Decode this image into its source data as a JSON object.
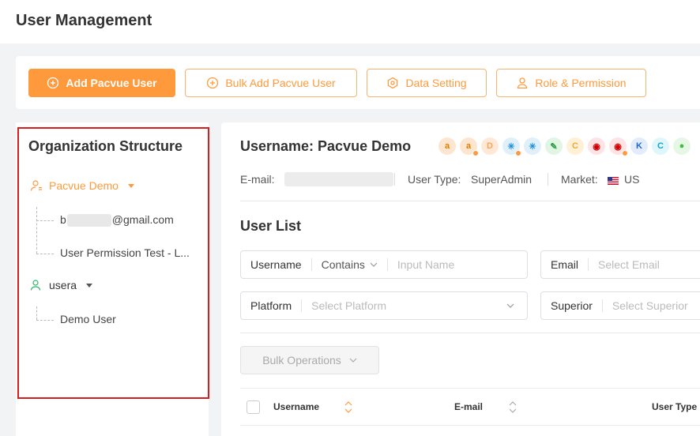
{
  "header": {
    "title": "User Management"
  },
  "toolbar": {
    "add_user": "Add Pacvue User",
    "bulk_add": "Bulk Add Pacvue User",
    "data_setting": "Data Setting",
    "role_permission": "Role & Permission"
  },
  "org": {
    "title": "Organization Structure",
    "nodes": [
      {
        "label": "Pacvue Demo",
        "children": [
          "b",
          "@gmail.com",
          "User Permission Test - L..."
        ]
      },
      {
        "label": "usera",
        "children": [
          "Demo User"
        ]
      }
    ]
  },
  "profile": {
    "username": "Username: Pacvue Demo",
    "email_label": "E-mail:",
    "user_type_label": "User Type:",
    "user_type": "SuperAdmin",
    "market_label": "Market:",
    "market": "US"
  },
  "logos": [
    {
      "icon": "amazon-icon",
      "text": "a",
      "bg": "#fde6cf",
      "fg": "#e07b00"
    },
    {
      "icon": "amazon-sub-icon",
      "text": "a",
      "bg": "#fde6cf",
      "fg": "#e07b00"
    },
    {
      "icon": "doordash-icon",
      "text": "D",
      "bg": "#ffe9d6",
      "fg": "#f7a35c"
    },
    {
      "icon": "walmart-sub-icon",
      "text": "✳",
      "bg": "#dff0fb",
      "fg": "#1b8fd6"
    },
    {
      "icon": "walmart-icon",
      "text": "✳",
      "bg": "#dff0fb",
      "fg": "#1b8fd6"
    },
    {
      "icon": "instacart-icon",
      "text": "✎",
      "bg": "#e1f5e4",
      "fg": "#2b9b45"
    },
    {
      "icon": "criteo-icon",
      "text": "C",
      "bg": "#fff0d6",
      "fg": "#f0a830"
    },
    {
      "icon": "target-icon",
      "text": "◉",
      "bg": "#fde3e3",
      "fg": "#cc0000"
    },
    {
      "icon": "target-sub-icon",
      "text": "◉",
      "bg": "#fde3e3",
      "fg": "#cc0000"
    },
    {
      "icon": "kroger-icon",
      "text": "K",
      "bg": "#e2ecfb",
      "fg": "#2566c8"
    },
    {
      "icon": "citrus-icon",
      "text": "C",
      "bg": "#dff6fb",
      "fg": "#17a3c8"
    },
    {
      "icon": "green-dot-icon",
      "text": "●",
      "bg": "#e6f7e6",
      "fg": "#3cbf3c"
    }
  ],
  "user_list": {
    "title": "User List",
    "filters": {
      "username_label": "Username",
      "username_mode": "Contains",
      "username_placeholder": "Input Name",
      "email_label": "Email",
      "email_placeholder": "Select Email",
      "platform_label": "Platform",
      "platform_placeholder": "Select Platform",
      "superior_label": "Superior",
      "superior_placeholder": "Select Superior"
    },
    "bulk_operations": "Bulk Operations",
    "columns": [
      "Username",
      "E-mail",
      "User Type"
    ]
  }
}
